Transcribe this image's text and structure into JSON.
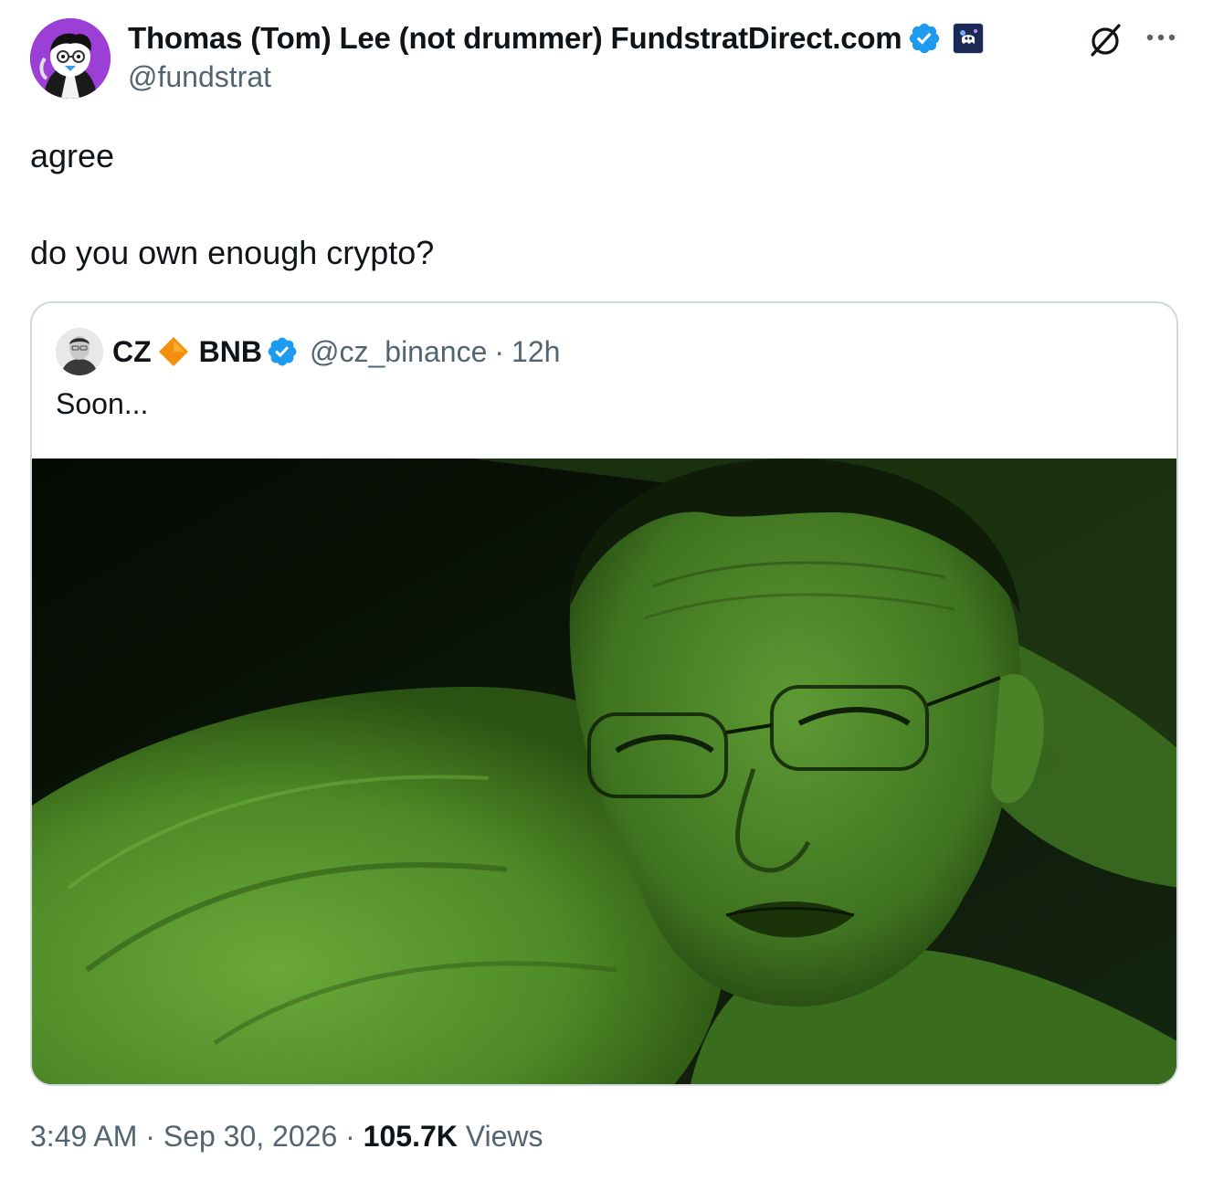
{
  "author": {
    "display_name": "Thomas (Tom) Lee (not drummer) FundstratDirect.com",
    "handle": "@fundstrat",
    "avatar_icon": "penguin-avatar",
    "verified_icon": "verified-badge-icon",
    "affiliate_icon": "affiliate-badge-icon"
  },
  "header_actions": {
    "grok_icon": "grok-icon",
    "more_icon": "more-options-icon"
  },
  "tweet": {
    "line1": "agree",
    "line2": "do you own enough crypto?"
  },
  "quote": {
    "display_name": "CZ",
    "emoji_icon": "orange-diamond-icon",
    "display_name_suffix": "BNB",
    "handle": "@cz_binance",
    "separator": "·",
    "time": "12h",
    "text": "Soon...",
    "media_icon": "night-vision-photo"
  },
  "footer": {
    "time": "3:49 AM",
    "sep1": "·",
    "date": "Sep 30, 2026",
    "sep2": "·",
    "views_count": "105.7K",
    "views_label": "Views"
  },
  "colors": {
    "verified": "#1d9bf0",
    "secondary_text": "#536471",
    "primary_text": "#0f1419",
    "border": "#cfd9de",
    "avatar_bg": "#9b3fd6",
    "night_vision_green": "#4f8a2c"
  }
}
